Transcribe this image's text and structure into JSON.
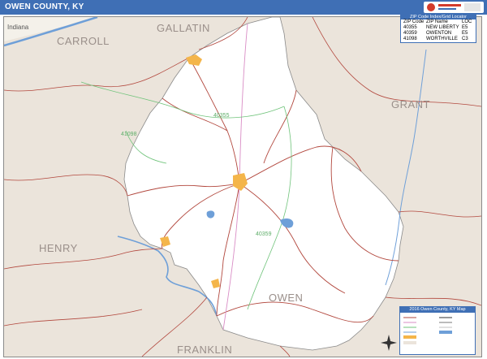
{
  "header": {
    "title": "OWEN COUNTY, KY"
  },
  "counties": {
    "carroll": "CARROLL",
    "gallatin": "GALLATIN",
    "grant": "GRANT",
    "henry": "HENRY",
    "franklin": "FRANKLIN",
    "owen": "OWEN"
  },
  "states": {
    "indiana": "Indiana"
  },
  "zip_labels": {
    "z1": "41098",
    "z2": "40355",
    "z3": "40359"
  },
  "zip_table": {
    "title": "ZIP Code Index/Grid Locator",
    "headers": [
      "ZIP Code",
      "ZIP Name",
      "LOC"
    ],
    "rows": [
      [
        "40355",
        "NEW LIBERTY",
        "E5"
      ],
      [
        "40359",
        "OWENTON",
        "E5"
      ],
      [
        "41098",
        "WORTHVILLE",
        "C3"
      ]
    ]
  },
  "legend": {
    "title": "2016 Owen County, KY Map"
  },
  "colors": {
    "title_bar": "#3f6fb5",
    "county_fill": "#ffffff",
    "surrounding_fill": "#ebe4db",
    "county_road": "#b2473d",
    "zip_boundary": "#6fc37a",
    "water": "#6e9fd8",
    "city": "#f4b54a"
  }
}
